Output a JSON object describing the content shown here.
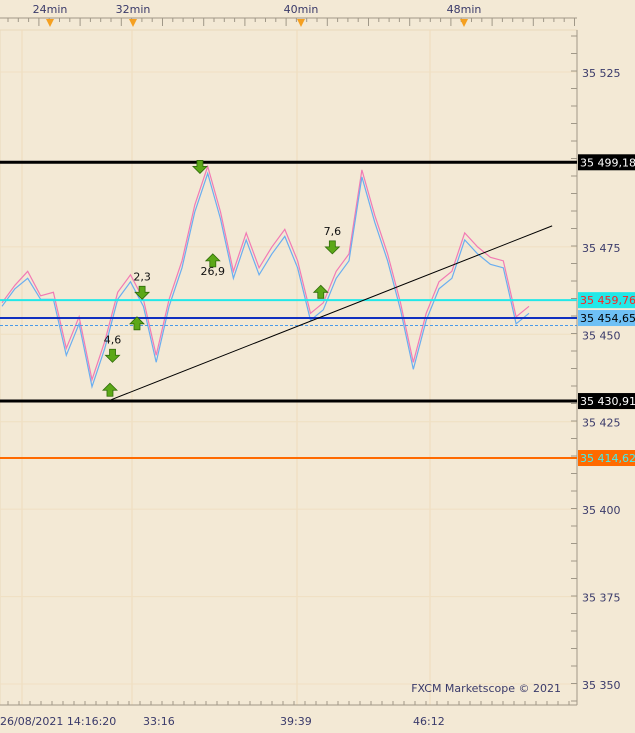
{
  "chart_data": {
    "type": "line",
    "top_axis_labels": [
      "24min",
      "32min",
      "40min",
      "48min"
    ],
    "bottom_axis_labels": [
      "26/08/2021 14:16:20",
      "33:16",
      "39:39",
      "46:12"
    ],
    "y_tick_labels": [
      "35 525",
      "35 475",
      "35 450",
      "35 425",
      "35 400",
      "35 375",
      "35 350"
    ],
    "y_ticks": [
      35525,
      35475,
      35450,
      35425,
      35400,
      35375,
      35350
    ],
    "ylim": [
      35343,
      35541
    ],
    "grid": true,
    "series": [
      {
        "color": "#f27ab4",
        "values": [
          35459,
          35464,
          35468,
          35461,
          35462,
          35446,
          35455,
          35437,
          35448,
          35462,
          35467,
          35460,
          35444,
          35460,
          35471,
          35487,
          35498,
          35485,
          35468,
          35479,
          35469,
          35475,
          35480,
          35471,
          35456,
          35459,
          35468,
          35473,
          35497,
          35484,
          35473,
          35459,
          35442,
          35456,
          35465,
          35468,
          35479,
          35475,
          35472,
          35471,
          35455,
          35458
        ]
      },
      {
        "color": "#6aaef0",
        "values": [
          35458,
          35463,
          35466,
          35460,
          35460,
          35444,
          35453,
          35435,
          35446,
          35460,
          35465,
          35458,
          35442,
          35458,
          35469,
          35485,
          35496,
          35483,
          35466,
          35477,
          35467,
          35473,
          35478,
          35469,
          35454,
          35457,
          35466,
          35471,
          35495,
          35482,
          35471,
          35457,
          35440,
          35454,
          35463,
          35466,
          35477,
          35473,
          35470,
          35469,
          35453,
          35456
        ]
      }
    ],
    "levels": [
      {
        "value": 35499.18,
        "label": "35 499,18",
        "color": "#000000",
        "text_color": "#ffffff",
        "width": 3
      },
      {
        "value": 35459.76,
        "label": "35 459,76",
        "color": "#22e8e8",
        "text_color": "#ff2020",
        "width": 2
      },
      {
        "value": 35454.65,
        "label": "35 454,65",
        "color": "#1030c0",
        "text_color": "#000000",
        "label_bg": "#6ec0f5",
        "width": 2
      },
      {
        "value": 35452.5,
        "label": "35 452,5",
        "color": "#4a9ae8",
        "dashed": true,
        "width": 1
      },
      {
        "value": 35430.91,
        "label": "35 430,91",
        "color": "#000000",
        "text_color": "#ffffff",
        "width": 3
      },
      {
        "value": 35414.62,
        "label": "35 414,62",
        "color": "#ff6a00",
        "text_color": "#40f0f0",
        "width": 2
      }
    ],
    "trendline": {
      "from": {
        "idx": 8.5,
        "price": 35431.3
      },
      "to": {
        "idx": 42.8,
        "price": 35481
      }
    },
    "signals": [
      {
        "dir": "up",
        "idx": 8.4,
        "price": 35434
      },
      {
        "dir": "down",
        "idx": 8.6,
        "price": 35444,
        "label": "4,6"
      },
      {
        "dir": "up",
        "idx": 10.5,
        "price": 35453
      },
      {
        "dir": "down",
        "idx": 10.9,
        "price": 35462,
        "label": "2,3"
      },
      {
        "dir": "down",
        "idx": 15.4,
        "price": 35498
      },
      {
        "dir": "up",
        "idx": 16.4,
        "price": 35471,
        "label": "26,9"
      },
      {
        "dir": "up",
        "idx": 24.8,
        "price": 35462
      },
      {
        "dir": "down",
        "idx": 25.7,
        "price": 35475,
        "label": "7,6"
      }
    ],
    "watermark": "FXCM Marketscope © 2021",
    "marker_color": "#f5a020"
  }
}
